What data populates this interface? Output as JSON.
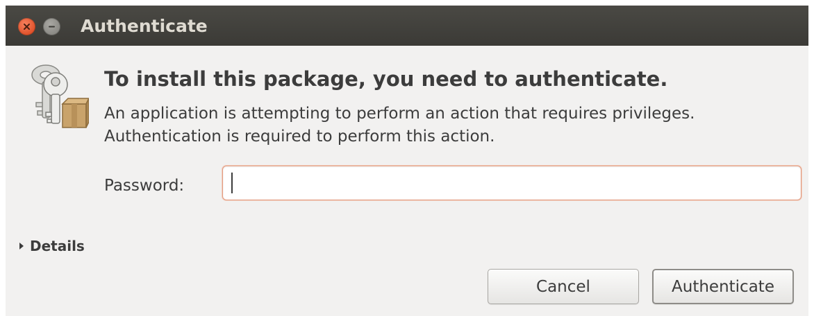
{
  "window": {
    "title": "Authenticate",
    "controls": {
      "close_icon": "close-icon",
      "minimize_icon": "minimize-icon"
    }
  },
  "dialog": {
    "icon": "keys-package-icon",
    "heading": "To install this package, you need to authenticate.",
    "description": "An application is attempting to perform an action that requires privileges. Authentication is required to perform this action.",
    "password": {
      "label": "Password:",
      "value": "",
      "placeholder": ""
    },
    "details": {
      "label": "Details",
      "expanded": false
    },
    "buttons": {
      "cancel": "Cancel",
      "authenticate": "Authenticate"
    }
  },
  "colors": {
    "titlebar": "#3c3b37",
    "close": "#e0512a",
    "input_focus_border": "#e39c80",
    "background": "#f2f1f0"
  }
}
